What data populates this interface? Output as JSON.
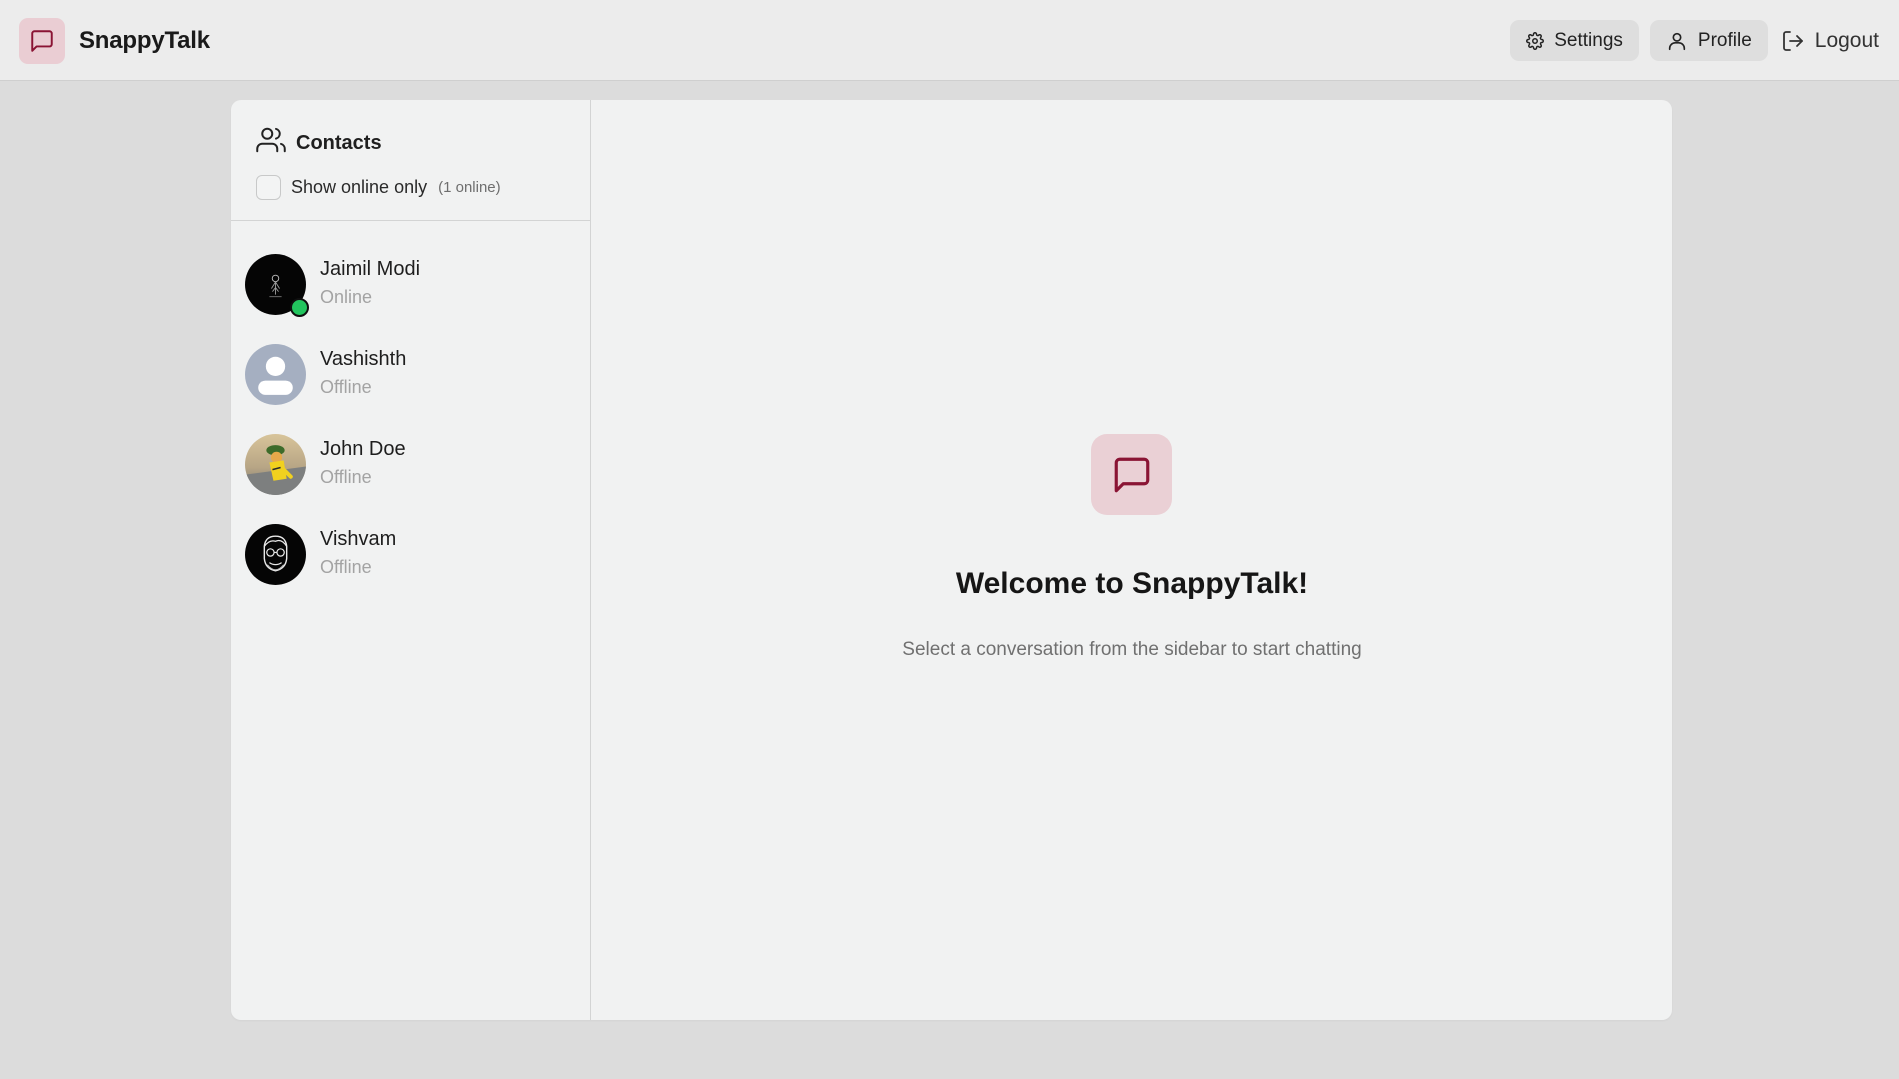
{
  "app": {
    "name": "SnappyTalk",
    "accent_color": "#8a1434",
    "accent_bg": "#eacdd3"
  },
  "navbar": {
    "settings_label": "Settings",
    "profile_label": "Profile",
    "logout_label": "Logout"
  },
  "sidebar": {
    "title": "Contacts",
    "filter_label": "Show online only",
    "online_count": "(1 online)",
    "filter_checked": false,
    "contacts": [
      {
        "name": "Jaimil Modi",
        "status": "Online",
        "avatar": "dark-figure-photo",
        "online": true
      },
      {
        "name": "Vashishth",
        "status": "Offline",
        "avatar": "default-user-avatar",
        "online": false
      },
      {
        "name": "John Doe",
        "status": "Offline",
        "avatar": "cartoon-character-photo",
        "online": false
      },
      {
        "name": "Vishvam",
        "status": "Offline",
        "avatar": "sketch-face-avatar",
        "online": false
      }
    ]
  },
  "welcome": {
    "title": "Welcome to SnappyTalk!",
    "subtitle": "Select a conversation from the sidebar to start chatting"
  },
  "icons": {
    "brand": "chat-bubble-icon",
    "settings": "gear-icon",
    "profile": "user-icon",
    "logout": "logout-icon",
    "contacts": "users-icon"
  },
  "colors": {
    "online": "#22c55e",
    "page_bg": "#dcdcdc",
    "card_bg": "#f1f2f2"
  }
}
